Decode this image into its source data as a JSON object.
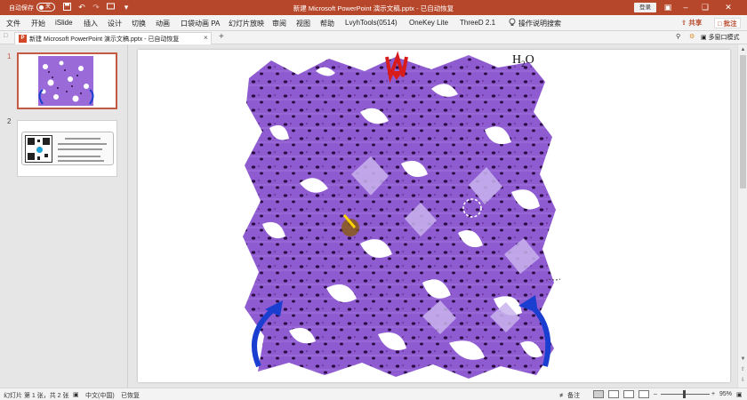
{
  "titlebar": {
    "autosave_label": "自动保存",
    "autosave_state": "关",
    "doc_title": "新建 Microsoft PowerPoint 演示文稿.pptx - 已自动恢复",
    "login_label": "登录"
  },
  "ribbon": {
    "tabs": [
      "文件",
      "开始",
      "iSlide",
      "插入",
      "设计",
      "切换",
      "动画",
      "口袋动画 PA",
      "幻灯片放映",
      "审阅",
      "视图",
      "帮助",
      "LvyhTools(0514)",
      "OneKey Lite",
      "ThreeD 2.1"
    ],
    "search_label": "操作说明搜索",
    "share_label": "共享",
    "comment_label": "批注"
  },
  "doc_tabs": {
    "file_name": "新建 Microsoft PowerPoint 演示文稿.pptx",
    "file_status": "已自动恢复",
    "multiwindow_label": "多窗口模式"
  },
  "slides": {
    "numbers": [
      "1",
      "2"
    ]
  },
  "slide": {
    "formula_main": "H",
    "formula_sub": "2",
    "formula_end": "O"
  },
  "statusbar": {
    "slide_info": "幻灯片 第 1 张，共 2 张",
    "language": "中文(中国)",
    "recovered": "已恢复",
    "notes_label": "备注",
    "zoom": "95%"
  },
  "colors": {
    "accent": "#b7472a",
    "framework": "#8f5bd1",
    "pores": "#2c0c45",
    "arrows": "#1a3fd0",
    "water_arrow": "#d81b1b"
  }
}
